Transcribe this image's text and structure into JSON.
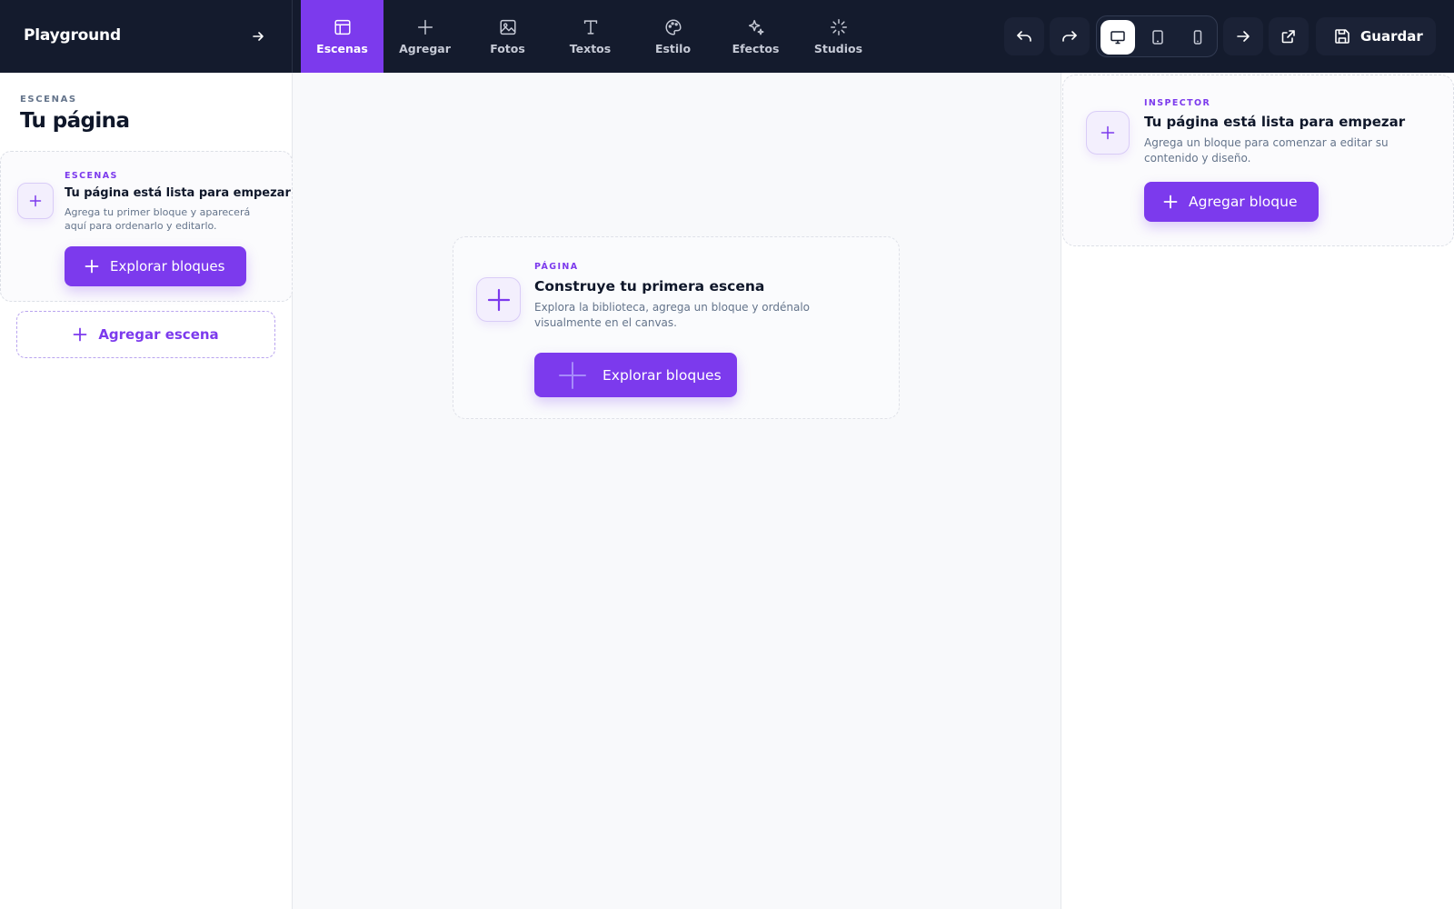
{
  "app": {
    "title": "Playground"
  },
  "nav": {
    "tabs": [
      {
        "label": "Escenas",
        "icon": "layout-icon",
        "active": true
      },
      {
        "label": "Agregar",
        "icon": "plus-icon"
      },
      {
        "label": "Fotos",
        "icon": "image-icon"
      },
      {
        "label": "Textos",
        "icon": "text-icon"
      },
      {
        "label": "Estilo",
        "icon": "palette-icon"
      },
      {
        "label": "Efectos",
        "icon": "sparkles-icon"
      },
      {
        "label": "Studios",
        "icon": "loader-icon"
      }
    ]
  },
  "toolbar": {
    "device_selected": "desktop",
    "save_label": "Guardar"
  },
  "sidebar": {
    "eyebrow": "ESCENAS",
    "title": "Tu página",
    "empty_card": {
      "eyebrow": "ESCENAS",
      "title": "Tu página está lista para empezar",
      "description": "Agrega tu primer bloque y aparecerá aquí para ordenarlo y editarlo.",
      "button_label": "Explorar bloques"
    },
    "add_scene_label": "Agregar escena"
  },
  "canvas": {
    "card": {
      "eyebrow": "PÁGINA",
      "title": "Construye tu primera escena",
      "description": "Explora la biblioteca, agrega un bloque y ordénalo visualmente en el canvas.",
      "button_label": "Explorar bloques"
    }
  },
  "inspector": {
    "card": {
      "eyebrow": "INSPECTOR",
      "title": "Tu página está lista para empezar",
      "description": "Agrega un bloque para comenzar a editar su contenido y diseño.",
      "button_label": "Agregar bloque"
    }
  },
  "colors": {
    "topbar": "#141b2d",
    "accent": "#7c3aed",
    "canvas_bg": "#f8f9fb"
  }
}
